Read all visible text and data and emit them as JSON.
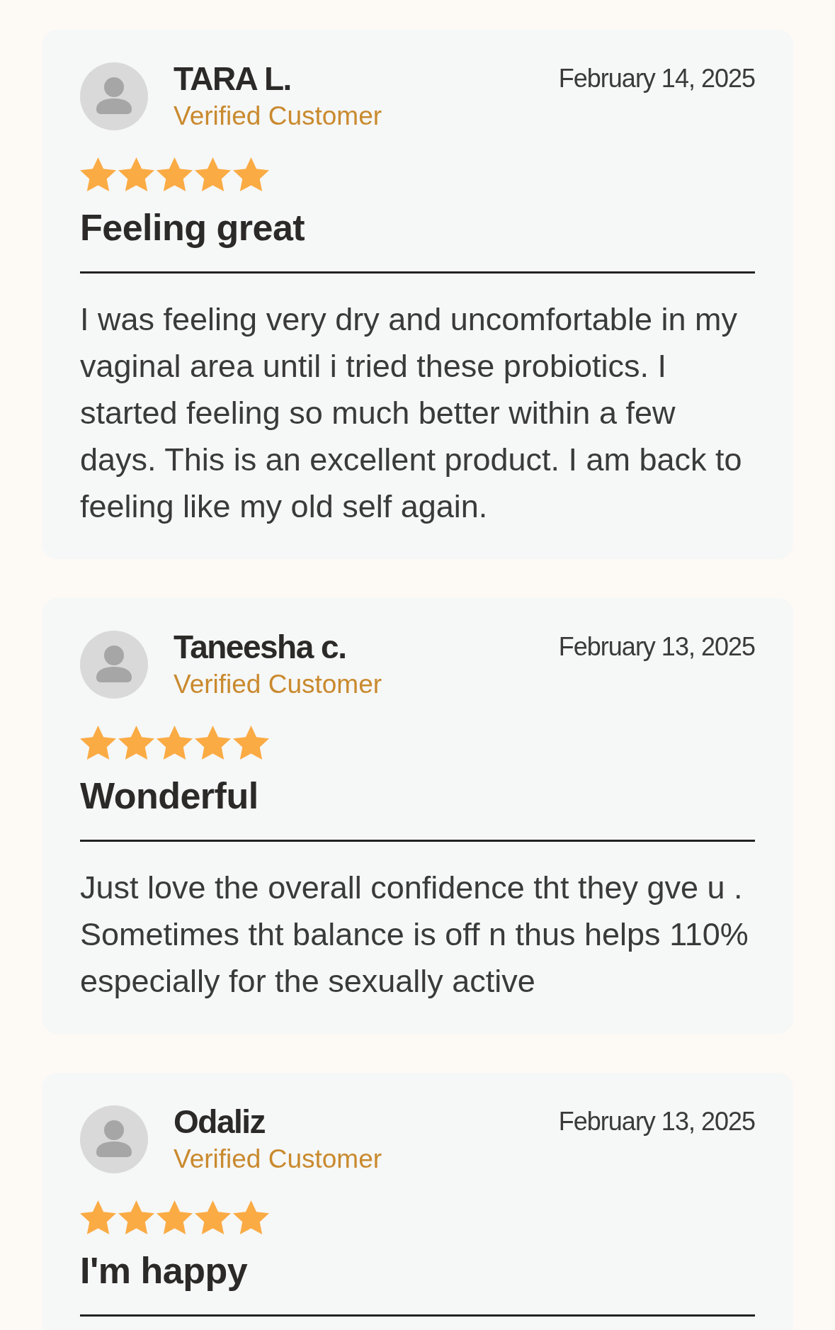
{
  "reviews": [
    {
      "author": "TARA L.",
      "badge": "Verified Customer",
      "date": "February 14, 2025",
      "stars": 5,
      "title": "Feeling great",
      "body": "I was feeling very dry and uncomfortable in my vaginal area until i tried these probiotics. I started feeling so much better within a few days. This is an excellent product. I am back to feeling like my old self again."
    },
    {
      "author": "Taneesha c.",
      "badge": "Verified Customer",
      "date": "February 13, 2025",
      "stars": 5,
      "title": "Wonderful",
      "body": "Just love the overall confidence tht they gve u . Sometimes tht balance is off n thus helps 110% especially for the sexually active"
    },
    {
      "author": "Odaliz",
      "badge": "Verified Customer",
      "date": "February 13, 2025",
      "stars": 5,
      "title": "I'm happy"
    }
  ]
}
